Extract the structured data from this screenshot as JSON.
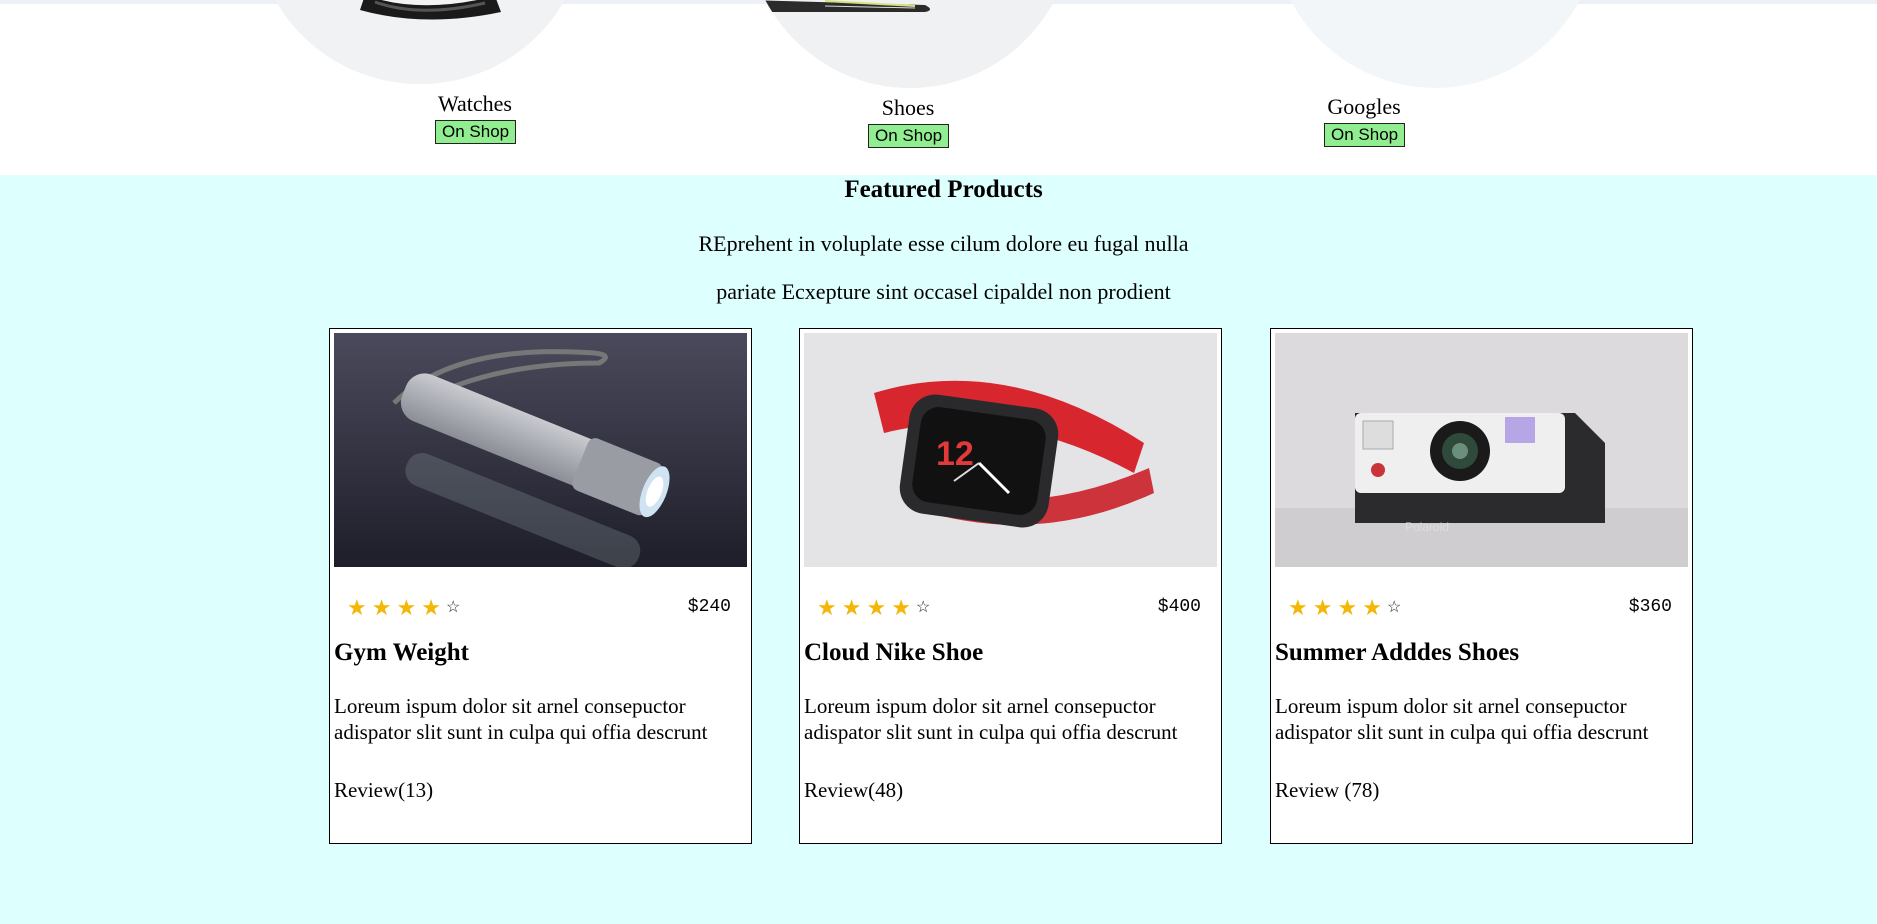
{
  "categories": [
    {
      "name": "Watches",
      "button": "On Shop"
    },
    {
      "name": "Shoes",
      "button": "On Shop"
    },
    {
      "name": "Googles",
      "button": "On Shop"
    }
  ],
  "featured": {
    "title": "Featured Products",
    "subtitle_line1": "REprehent in voluplate esse cilum dolore eu fugal nulla",
    "subtitle_line2": "pariate Ecxepture sint occasel cipaldel non prodient",
    "products": [
      {
        "title": "Gym Weight",
        "price": "$240",
        "rating": 4,
        "max_rating": 5,
        "desc": "Loreum ispum dolor sit arnel consepuctor adispator slit sunt in culpa qui offia descrunt",
        "review": "Review(13)"
      },
      {
        "title": "Cloud Nike Shoe",
        "price": "$400",
        "rating": 4,
        "max_rating": 5,
        "desc": "Loreum ispum dolor sit arnel consepuctor adispator slit sunt in culpa qui offia descrunt",
        "review": "Review(48)"
      },
      {
        "title": "Summer Adddes Shoes",
        "price": "$360",
        "rating": 4,
        "max_rating": 5,
        "desc": "Loreum ispum dolor sit arnel consepuctor adispator slit sunt in culpa qui offia descrunt",
        "review": "Review (78)"
      }
    ]
  },
  "colors": {
    "section_bg": "#ddfffe",
    "button_bg": "#90ee90",
    "star": "#f2b707"
  },
  "icons": [
    "star-icon",
    "star-outline-icon"
  ]
}
